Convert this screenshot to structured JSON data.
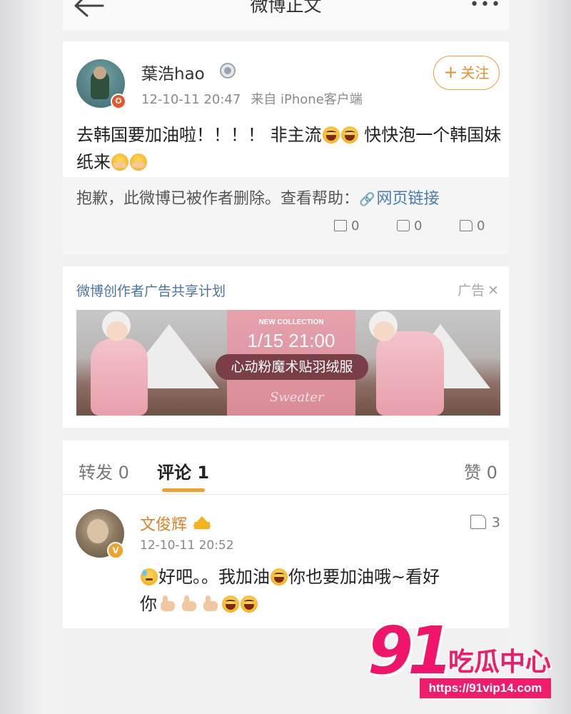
{
  "nav": {
    "title": "微博正文",
    "more": "•••"
  },
  "post": {
    "user": "葉浩hao",
    "badge": "✪",
    "time": "12-10-11 20:47",
    "source": "来自 iPhone客户端",
    "follow_label": "关注",
    "text_part1": "去韩国要加油啦！！！！ 非主流",
    "text_part2": " 快快泡一个韩国妹纸来",
    "deleted_msg": "抱歉，此微博已被作者删除。查看帮助：",
    "deleted_link": "网页链接",
    "repost_count": "0",
    "comment_count": "0",
    "like_count": "0"
  },
  "ad": {
    "title": "微博创作者广告共享计划",
    "tag": "广告",
    "close": "✕",
    "banner": {
      "small": "NEW COLLECTION",
      "date": "1/15 21:00",
      "pill": "心动粉魔术贴羽绒服",
      "script": "Sweater"
    }
  },
  "comments_section": {
    "tabs": [
      {
        "label": "转发 0"
      },
      {
        "label": "评论 1"
      },
      {
        "label": "赞 0"
      }
    ],
    "active_tab": "评论 1",
    "items": [
      {
        "user": "文俊辉",
        "badge": "V",
        "time": "12-10-11 20:52",
        "likes": "3",
        "text_part1": "好吧。。我加油",
        "text_part2": "你也要加油哦~看好",
        "text_part3": "你"
      }
    ]
  },
  "watermark": {
    "num": "91",
    "cn": "吃瓜中心",
    "url": "https://91vip14.com"
  },
  "colors": {
    "accent": "#e0922c",
    "link": "#4b7cb0",
    "watermark": "#ef1b6b",
    "verified": "#f0a32c"
  },
  "icons": [
    "back-arrow-icon",
    "more-icon",
    "link-icon",
    "repost-icon",
    "comment-icon",
    "like-icon",
    "close-icon",
    "crown-icon",
    "vip-icon"
  ]
}
